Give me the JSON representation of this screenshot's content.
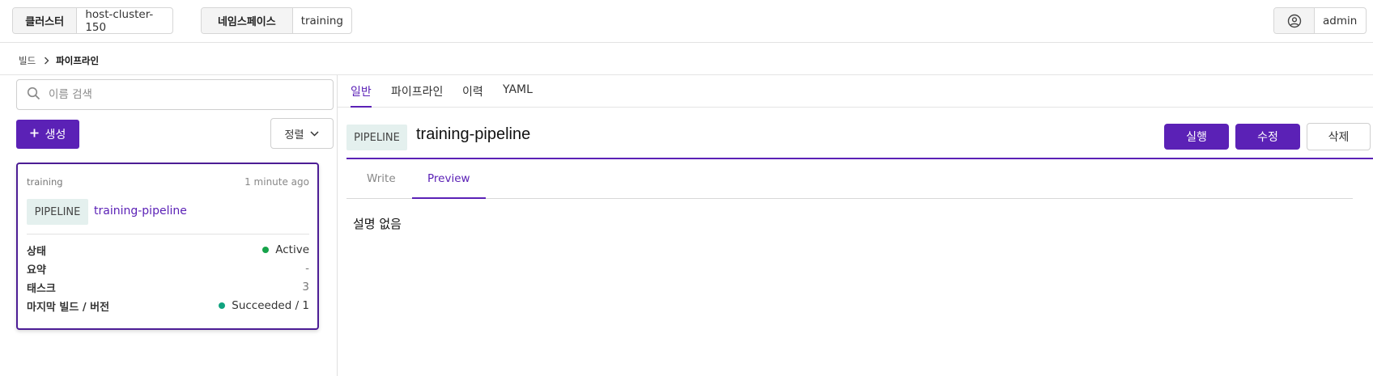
{
  "topbar": {
    "cluster_label": "클러스터",
    "cluster_value": "host-cluster-150",
    "namespace_label": "네임스페이스",
    "namespace_value": "training",
    "user_icon": "user-circle-icon",
    "user_name": "admin"
  },
  "breadcrumb": {
    "items": [
      "빌드",
      "파이프라인"
    ],
    "separator_icon": "chevron-right-icon"
  },
  "sidebar": {
    "search_placeholder": "이름 검색",
    "search_icon": "search-icon",
    "create_label": "생성",
    "create_icon": "plus-icon",
    "sort_label": "정렬",
    "sort_icon": "chevron-down-icon",
    "card": {
      "namespace": "training",
      "time": "1 minute ago",
      "kind": "PIPELINE",
      "name": "training-pipeline",
      "rows": [
        {
          "label": "상태",
          "value": "Active",
          "status_color": "#16a34a"
        },
        {
          "label": "요약",
          "value": "-"
        },
        {
          "label": "태스크",
          "value": "3"
        },
        {
          "label": "마지막 빌드 / 버전",
          "value": "Succeeded / 1",
          "status_color": "#10a37f"
        }
      ]
    }
  },
  "main": {
    "tabs": [
      {
        "label": "일반",
        "active": true
      },
      {
        "label": "파이프라인",
        "active": false
      },
      {
        "label": "이력",
        "active": false
      },
      {
        "label": "YAML",
        "active": false
      }
    ],
    "kind": "PIPELINE",
    "title": "training-pipeline",
    "actions": {
      "run": "실행",
      "edit": "수정",
      "delete": "삭제"
    },
    "subtabs": [
      {
        "label": "Write",
        "active": false
      },
      {
        "label": "Preview",
        "active": true
      }
    ],
    "description": "설명 없음"
  },
  "colors": {
    "accent": "#5b21b6",
    "badge_bg": "#e4f0ee",
    "active_status": "#16a34a"
  }
}
